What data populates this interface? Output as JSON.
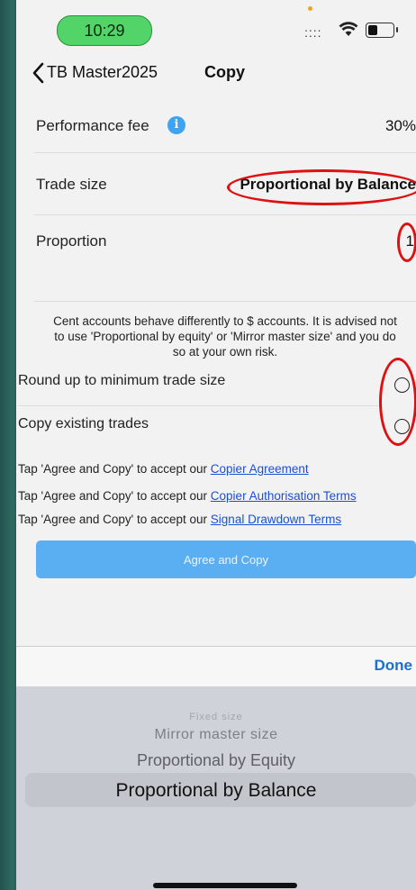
{
  "status_bar": {
    "time": "10:29",
    "signal": "::::",
    "icons": [
      "wifi-icon",
      "battery-icon"
    ]
  },
  "nav": {
    "back_label": "TB Master2025",
    "title": "Copy"
  },
  "settings": {
    "performance_fee": {
      "label": "Performance fee",
      "value": "30%"
    },
    "trade_size": {
      "label": "Trade size",
      "value": "Proportional by Balance"
    },
    "proportion": {
      "label": "Proportion",
      "value": "1"
    }
  },
  "note": "Cent accounts behave differently to $ accounts. It is advised not to use 'Proportional by equity' or 'Mirror master size' and you do so at your own risk.",
  "toggles": {
    "round_up": {
      "label": "Round up to minimum trade size",
      "selected": false
    },
    "copy_existing": {
      "label": "Copy existing trades",
      "selected": false
    }
  },
  "terms": [
    {
      "prefix": "Tap 'Agree and Copy' to accept our ",
      "link": "Copier Agreement"
    },
    {
      "prefix": "Tap 'Agree and Copy' to accept our ",
      "link": "Copier Authorisation Terms"
    },
    {
      "prefix": "Tap 'Agree and Copy' to accept our ",
      "link": "Signal Drawdown Terms"
    }
  ],
  "agree_button": "Agree and Copy",
  "picker": {
    "done_label": "Done",
    "options": [
      "Fixed size",
      "Mirror master size",
      "Proportional by Equity",
      "Proportional by Balance"
    ],
    "selected": "Proportional by Balance"
  },
  "colors": {
    "accent": "#1a6fd6",
    "button": "#5aaff2",
    "annotation": "#dd1111",
    "status_pill": "#53d469"
  }
}
